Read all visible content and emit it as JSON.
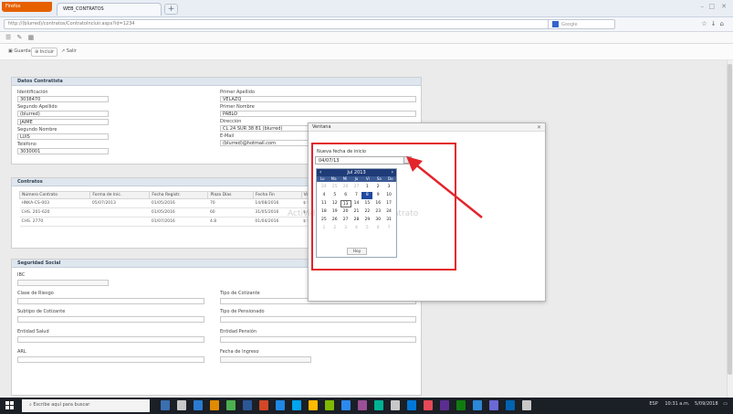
{
  "browser": {
    "app_button": "Firefox",
    "tab_title": "WEB_CONTRATOS",
    "url": "http://(blurred)/contratos/ContratoIncluir.aspx?id=1234",
    "search_placeholder": "Google"
  },
  "app": {
    "actions": [
      "Guardar",
      "Incluir",
      "Salir"
    ]
  },
  "sections": {
    "datos": {
      "title": "Datos Contratista",
      "left": [
        {
          "label": "Identificación",
          "value": "3038470"
        },
        {
          "label": "Segundo Apellido",
          "value": "(blurred)"
        },
        {
          "label": "Segundo Nombre",
          "value": "LUIS"
        },
        {
          "label": "Teléfono",
          "value": "3030001"
        }
      ],
      "right": [
        {
          "label": "Primer Apellido",
          "value": "VELAZQ"
        },
        {
          "label": "Primer Nombre",
          "value": "PABLO"
        },
        {
          "label": "Dirección",
          "value": "CL 24 SUR 38 81 (blurred)"
        },
        {
          "label": "E-Mail",
          "value": "(blurred)@hotmail.com"
        }
      ],
      "extra_left_value": "JAIME"
    },
    "contratos": {
      "title": "Contratos",
      "columns": [
        "Número Contrato",
        "Forma de Inic.",
        "Fecha Registr.",
        "Plazo Días",
        "Fecha Fin",
        "Valor",
        "Contratista"
      ],
      "rows": [
        [
          "HNKA-CS-003",
          "05/07/2013",
          "01/05/2016",
          "70",
          "14/08/2016",
          "$ 9.087.126.00",
          "2795"
        ],
        [
          "CHS. 201-620",
          "",
          "01/05/2016",
          "60",
          "31/05/2016",
          "$ 9.584.360.00",
          "10"
        ],
        [
          "CHS. 2770",
          "",
          "01/07/2016",
          "4.8",
          "01/04/2016",
          "$ 9.482.360.00",
          "20"
        ]
      ]
    },
    "seguridad": {
      "title": "Seguridad Social",
      "fields": [
        {
          "label": "IBC",
          "value": ""
        },
        {
          "label": "Clase de Riesgo",
          "value": ""
        },
        {
          "label": "Tipo de Cotizante",
          "value": ""
        },
        {
          "label": "Subtipo de Cotizante",
          "value": ""
        },
        {
          "label": "Tipo de Pensionado",
          "value": ""
        },
        {
          "label": "Entidad Salud",
          "value": ""
        },
        {
          "label": "Entidad Pensión",
          "value": ""
        },
        {
          "label": "ARL",
          "value": ""
        },
        {
          "label": "Fecha de Ingreso",
          "value": ""
        }
      ]
    }
  },
  "dialog": {
    "title": "Ventana",
    "field_label": "Nueva fecha de inicio",
    "field_value": "04/07/13",
    "watermark": "Actividades y Prórroga Contrato"
  },
  "calendar": {
    "month_label": "Jul 2013",
    "weekdays": [
      "Lu",
      "Ma",
      "Mi",
      "Ju",
      "Vi",
      "Sa",
      "Do"
    ],
    "days": [
      {
        "d": "24",
        "o": true
      },
      {
        "d": "25",
        "o": true
      },
      {
        "d": "26",
        "o": true
      },
      {
        "d": "27",
        "o": true
      },
      {
        "d": "1"
      },
      {
        "d": "2"
      },
      {
        "d": "3"
      },
      {
        "d": "4"
      },
      {
        "d": "5"
      },
      {
        "d": "6"
      },
      {
        "d": "7"
      },
      {
        "d": "8",
        "s": true
      },
      {
        "d": "9"
      },
      {
        "d": "10"
      },
      {
        "d": "11"
      },
      {
        "d": "12"
      },
      {
        "d": "13",
        "t": true
      },
      {
        "d": "14"
      },
      {
        "d": "15"
      },
      {
        "d": "16"
      },
      {
        "d": "17"
      },
      {
        "d": "18"
      },
      {
        "d": "19"
      },
      {
        "d": "20"
      },
      {
        "d": "21"
      },
      {
        "d": "22"
      },
      {
        "d": "23"
      },
      {
        "d": "24"
      },
      {
        "d": "25"
      },
      {
        "d": "26"
      },
      {
        "d": "27"
      },
      {
        "d": "28"
      },
      {
        "d": "29"
      },
      {
        "d": "30"
      },
      {
        "d": "31"
      },
      {
        "d": "1",
        "o": true
      },
      {
        "d": "2",
        "o": true
      },
      {
        "d": "3",
        "o": true
      },
      {
        "d": "4",
        "o": true
      },
      {
        "d": "5",
        "o": true
      },
      {
        "d": "6",
        "o": true
      },
      {
        "d": "7",
        "o": true
      }
    ],
    "today_button": "Hoy"
  },
  "taskbar": {
    "search_text": "Escribe aquí para buscar",
    "tray_text": "ESP",
    "time": "10:31 a.m.",
    "date": "5/09/2018"
  },
  "colors": {
    "highlight": "#e3242b",
    "calendar_header": "#1f3c78",
    "panel_header": "#dfe6ee",
    "taskbar": "#1b1f26"
  }
}
